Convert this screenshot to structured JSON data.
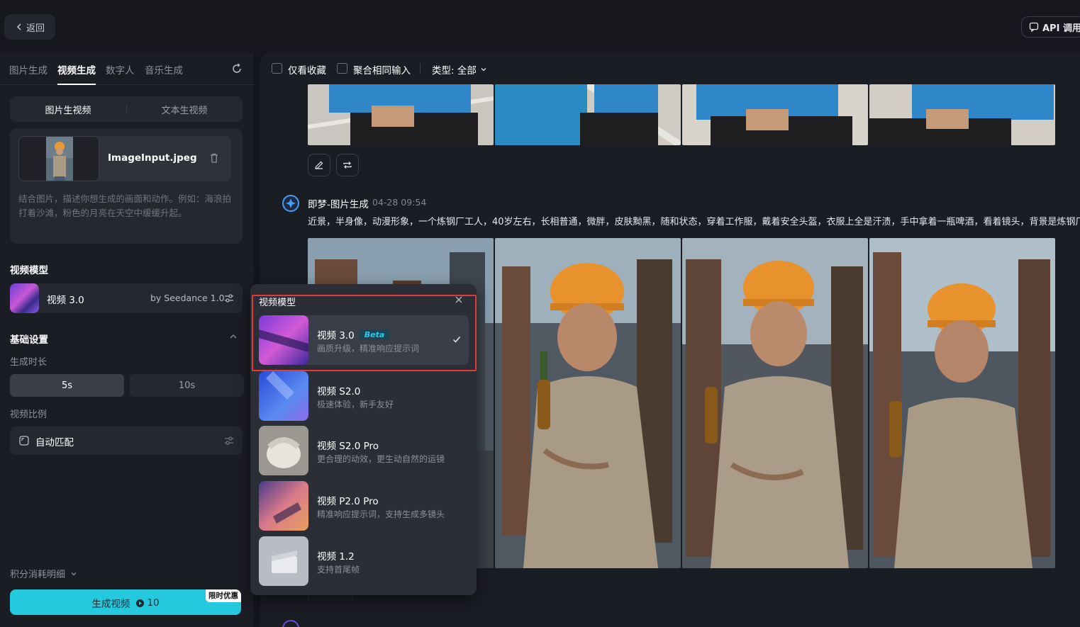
{
  "topbar": {
    "back_label": "返回",
    "api_label": "API 调用"
  },
  "left": {
    "tabs": [
      {
        "label": "图片生成",
        "active": false
      },
      {
        "label": "视频生成",
        "active": true
      },
      {
        "label": "数字人",
        "active": false
      },
      {
        "label": "音乐生成",
        "active": false
      }
    ],
    "mode_tabs": [
      {
        "label": "图片生视频",
        "active": true
      },
      {
        "label": "文本生视频",
        "active": false
      }
    ],
    "upload": {
      "file_name": "ImageInput.jpeg",
      "prompt_placeholder": "结合图片，描述你想生成的画面和动作。例如：海浪拍打着沙滩，粉色的月亮在天空中缓缓升起。"
    },
    "model_section_label": "视频模型",
    "model": {
      "name": "视频 3.0",
      "by": "by Seedance 1.0"
    },
    "basic_settings_label": "基础设置",
    "duration_label": "生成时长",
    "durations": [
      {
        "label": "5s",
        "active": true
      },
      {
        "label": "10s",
        "active": false
      }
    ],
    "ratio_label": "视频比例",
    "ratio_value": "自动匹配",
    "cost_label": "积分消耗明细",
    "generate": {
      "label": "生成视频",
      "cost": "10",
      "promo": "限时优惠"
    }
  },
  "right": {
    "filters": {
      "favorites_label": "仅看收藏",
      "merge_label": "聚合相同输入",
      "type_label": "类型: 全部"
    },
    "generation": {
      "title": "即梦-图片生成",
      "time": "04-28  09:54",
      "prompt": "近景，半身像，动漫形象，一个炼钢厂工人，40岁左右，长相普通，微胖，皮肤黝黑，随和状态，穿着工作服，戴着安全头盔，衣服上全是汗渍，手中拿着一瓶啤酒，看着镜头，背景是炼钢厂"
    }
  },
  "popup": {
    "title": "视频模型",
    "options": [
      {
        "name": "视频 3.0",
        "badge": "Beta",
        "desc": "画质升级，精准响应提示词",
        "selected": true
      },
      {
        "name": "视频 S2.0",
        "badge": "",
        "desc": "极速体验，新手友好",
        "selected": false
      },
      {
        "name": "视频 S2.0 Pro",
        "badge": "",
        "desc": "更合理的动效，更生动自然的运镜",
        "selected": false
      },
      {
        "name": "视频 P2.0 Pro",
        "badge": "",
        "desc": "精准响应提示词，支持生成多镜头",
        "selected": false
      },
      {
        "name": "视频 1.2",
        "badge": "",
        "desc": "支持首尾帧",
        "selected": false
      }
    ]
  },
  "colors": {
    "accent": "#25c9dd",
    "highlight": "#e53935",
    "beta": "#2ec7ea"
  }
}
